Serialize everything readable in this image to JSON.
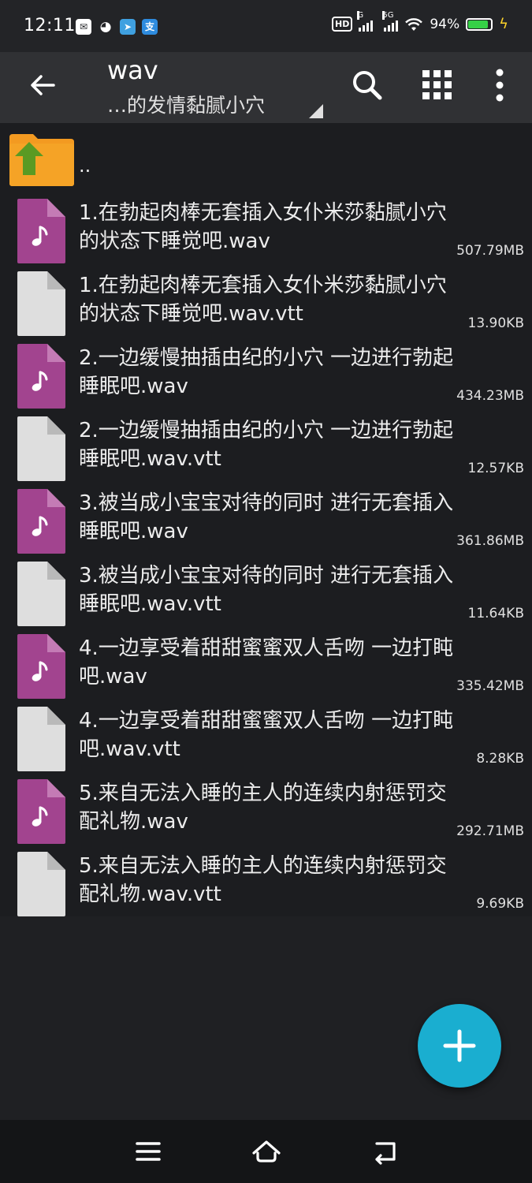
{
  "status_bar": {
    "time": "12:11",
    "battery_percent": "94%",
    "battery_level": 0.94,
    "signal_1_label": "G",
    "signal_2_label": "5G",
    "hd_label": "HD",
    "alipay_label": "支"
  },
  "toolbar": {
    "title": "wav",
    "subtitle": "…的发情黏腻小穴"
  },
  "list": {
    "parent_label": "..",
    "files": [
      {
        "name": "1.在勃起肉棒无套插入女仆米莎黏腻小穴的状态下睡觉吧.wav",
        "size": "507.79MB",
        "type": "audio"
      },
      {
        "name": "1.在勃起肉棒无套插入女仆米莎黏腻小穴的状态下睡觉吧.wav.vtt",
        "size": "13.90KB",
        "type": "generic"
      },
      {
        "name": "2.一边缓慢抽插由纪的小穴 一边进行勃起睡眠吧.wav",
        "size": "434.23MB",
        "type": "audio"
      },
      {
        "name": "2.一边缓慢抽插由纪的小穴 一边进行勃起睡眠吧.wav.vtt",
        "size": "12.57KB",
        "type": "generic"
      },
      {
        "name": "3.被当成小宝宝对待的同时 进行无套插入睡眠吧.wav",
        "size": "361.86MB",
        "type": "audio"
      },
      {
        "name": "3.被当成小宝宝对待的同时 进行无套插入睡眠吧.wav.vtt",
        "size": "11.64KB",
        "type": "generic"
      },
      {
        "name": "4.一边享受着甜甜蜜蜜双人舌吻 一边打盹吧.wav",
        "size": "335.42MB",
        "type": "audio"
      },
      {
        "name": "4.一边享受着甜甜蜜蜜双人舌吻 一边打盹吧.wav.vtt",
        "size": "8.28KB",
        "type": "generic"
      },
      {
        "name": "5.来自无法入睡的主人的连续内射惩罚交配礼物.wav",
        "size": "292.71MB",
        "type": "audio"
      },
      {
        "name": "5.来自无法入睡的主人的连续内射惩罚交配礼物.wav.vtt",
        "size": "9.69KB",
        "type": "generic"
      }
    ]
  },
  "colors": {
    "accent": "#1aaed0",
    "audio_icon": "#a2448f",
    "folder": "#f39a21",
    "arrow": "#5a9a23"
  }
}
